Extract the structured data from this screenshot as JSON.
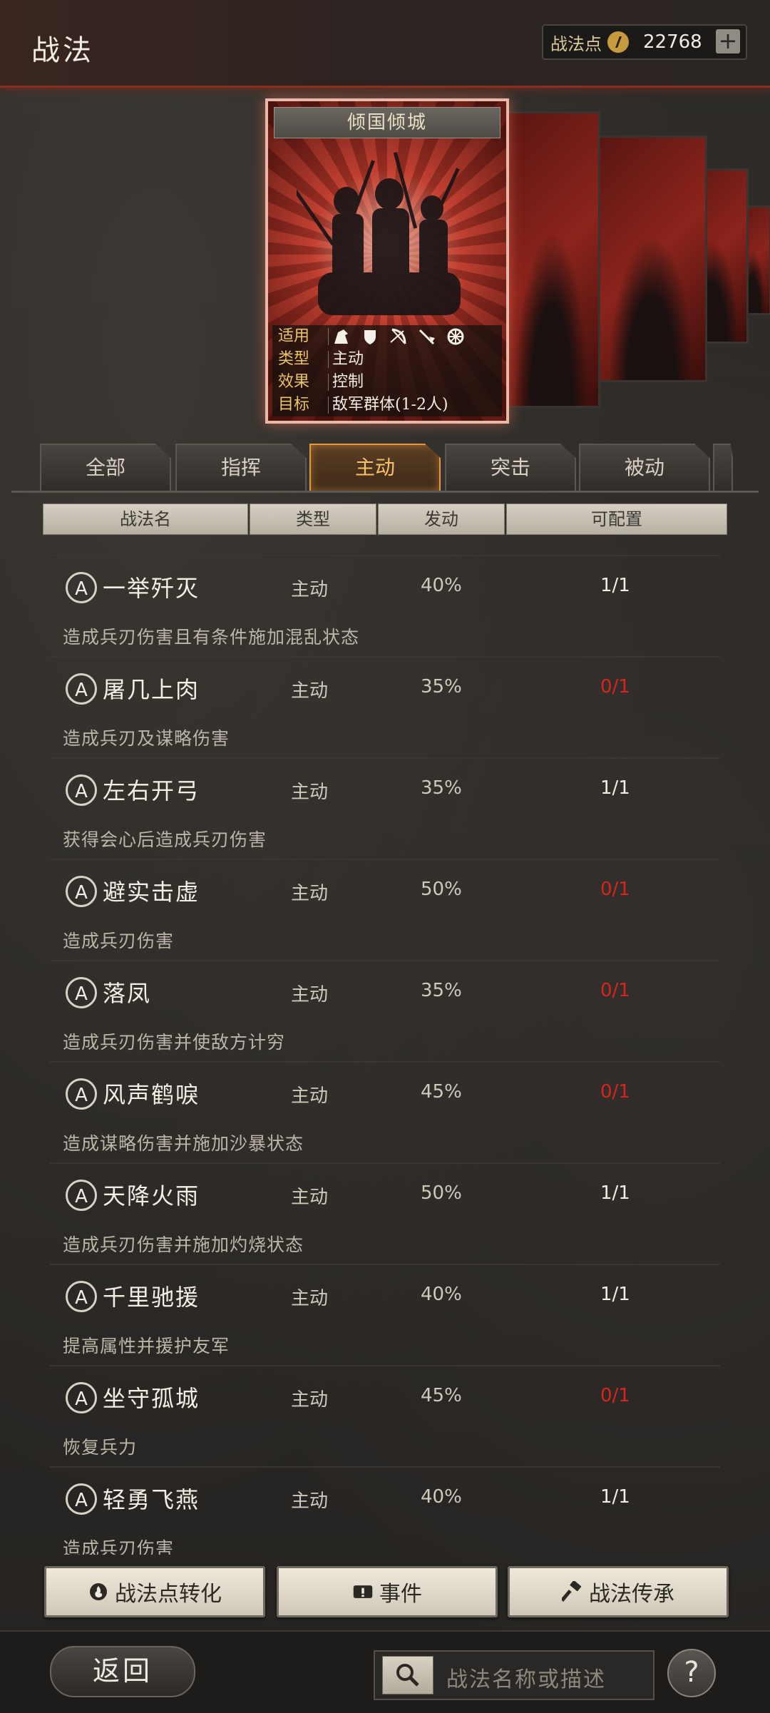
{
  "header": {
    "title": "战法",
    "points_label": "战法点",
    "points_value": "22768",
    "points_icon": "coin-icon",
    "plus_label": "+"
  },
  "featured": {
    "name": "倾国倾城",
    "rows": [
      {
        "key": "适用",
        "value": ""
      },
      {
        "key": "类型",
        "value": "主动"
      },
      {
        "key": "效果",
        "value": "控制"
      },
      {
        "key": "目标",
        "value": "敌军群体(1-2人)"
      }
    ],
    "apply_icons": [
      "cavalry-icon",
      "shield-icon",
      "bow-icon",
      "spear-icon",
      "wheel-icon"
    ]
  },
  "tabs": [
    {
      "label": "全部"
    },
    {
      "label": "指挥"
    },
    {
      "label": "主动",
      "active": true
    },
    {
      "label": "突击"
    },
    {
      "label": "被动"
    }
  ],
  "columns": [
    "战法名",
    "类型",
    "发动",
    "可配置"
  ],
  "skills": [
    {
      "badge": "A",
      "name": "一举歼灭",
      "type": "主动",
      "rate": "40%",
      "cap": "1/1",
      "desc": "造成兵刃伤害且有条件施加混乱状态"
    },
    {
      "badge": "A",
      "name": "屠几上肉",
      "type": "主动",
      "rate": "35%",
      "cap": "0/1",
      "desc": "造成兵刃及谋略伤害"
    },
    {
      "badge": "A",
      "name": "左右开弓",
      "type": "主动",
      "rate": "35%",
      "cap": "1/1",
      "desc": "获得会心后造成兵刃伤害"
    },
    {
      "badge": "A",
      "name": "避实击虚",
      "type": "主动",
      "rate": "50%",
      "cap": "0/1",
      "desc": "造成兵刃伤害"
    },
    {
      "badge": "A",
      "name": "落凤",
      "type": "主动",
      "rate": "35%",
      "cap": "0/1",
      "desc": "造成兵刃伤害并使敌方计穷"
    },
    {
      "badge": "A",
      "name": "风声鹤唳",
      "type": "主动",
      "rate": "45%",
      "cap": "0/1",
      "desc": "造成谋略伤害并施加沙暴状态"
    },
    {
      "badge": "A",
      "name": "天降火雨",
      "type": "主动",
      "rate": "50%",
      "cap": "1/1",
      "desc": "造成兵刃伤害并施加灼烧状态"
    },
    {
      "badge": "A",
      "name": "千里驰援",
      "type": "主动",
      "rate": "40%",
      "cap": "1/1",
      "desc": "提高属性并援护友军"
    },
    {
      "badge": "A",
      "name": "坐守孤城",
      "type": "主动",
      "rate": "45%",
      "cap": "0/1",
      "desc": "恢复兵力"
    },
    {
      "badge": "A",
      "name": "轻勇飞燕",
      "type": "主动",
      "rate": "40%",
      "cap": "1/1",
      "desc": "造成兵刃伤害"
    }
  ],
  "buttons": {
    "convert": "战法点转化",
    "events": "事件",
    "inherit": "战法传承"
  },
  "footer": {
    "back": "返回",
    "search_placeholder": "战法名称或描述",
    "help": "?"
  }
}
